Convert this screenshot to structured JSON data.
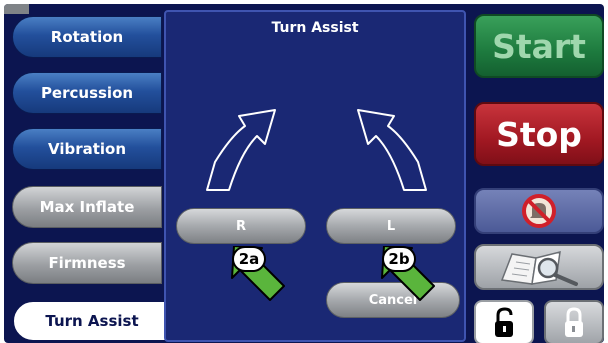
{
  "sidebar": {
    "tabs": [
      {
        "label": "Rotation"
      },
      {
        "label": "Percussion"
      },
      {
        "label": "Vibration"
      },
      {
        "label": "Max Inflate"
      },
      {
        "label": "Firmness"
      },
      {
        "label": "Turn Assist",
        "active": true
      }
    ]
  },
  "panel": {
    "title": "Turn Assist",
    "right_button": "R",
    "left_button": "L",
    "cancel_button": "Cancel"
  },
  "actions": {
    "start": "Start",
    "stop": "Stop"
  },
  "icons": {
    "mute": "silence-alarm-icon",
    "manual": "manual-magnifier-icon",
    "unlock": "unlock-icon",
    "lock": "lock-icon"
  },
  "callouts": {
    "a": "2a",
    "b": "2b"
  },
  "colors": {
    "background": "#0c1550",
    "start": "#1d7a3e",
    "stop": "#a11822",
    "callout_arrow": "#5ab53c"
  }
}
